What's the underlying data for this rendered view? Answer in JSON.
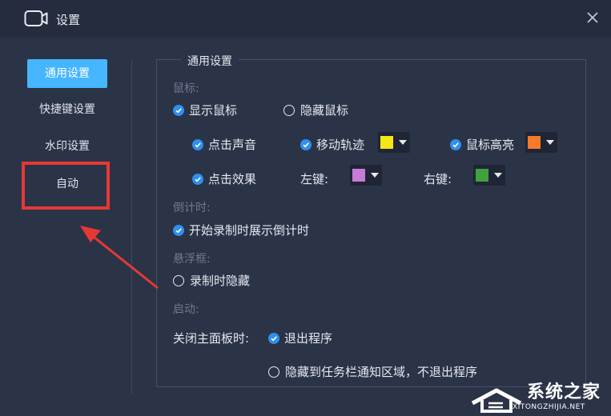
{
  "window": {
    "title": "设置"
  },
  "sidebar": {
    "items": [
      {
        "label": "通用设置",
        "active": true
      },
      {
        "label": "快捷键设置",
        "active": false
      },
      {
        "label": "水印设置",
        "active": false
      },
      {
        "label": "自动",
        "active": false
      }
    ]
  },
  "general": {
    "group_title": "通用设置",
    "mouse": {
      "section": "鼠标:",
      "show_cursor": "显示鼠标",
      "hide_cursor": "隐藏鼠标",
      "click_sound": "点击声音",
      "move_trail": "移动轨迹",
      "cursor_highlight": "鼠标高亮",
      "click_effect": "点击效果",
      "left_key": "左键:",
      "right_key": "右键:"
    },
    "countdown": {
      "section": "倒计时:",
      "show_on_start": "开始录制时展示倒计时"
    },
    "floating": {
      "section": "悬浮框:",
      "hide_on_record": "录制时隐藏"
    },
    "startup": {
      "section": "启动:",
      "close_label": "关闭主面板时:",
      "exit_program": "退出程序",
      "hide_to_tray": "隐藏到任务栏通知区域，不退出程序"
    }
  },
  "colors": {
    "accent": "#45b6ff",
    "check": "#2f8ff0",
    "trail": "#f5e61a",
    "highlight": "#f77b2a",
    "left_click": "#c77cd9",
    "right_click": "#3fa23f",
    "annotation": "#e53935"
  },
  "watermark": {
    "text": "系统之家",
    "url": "XITONGZHIJIA.NET"
  }
}
